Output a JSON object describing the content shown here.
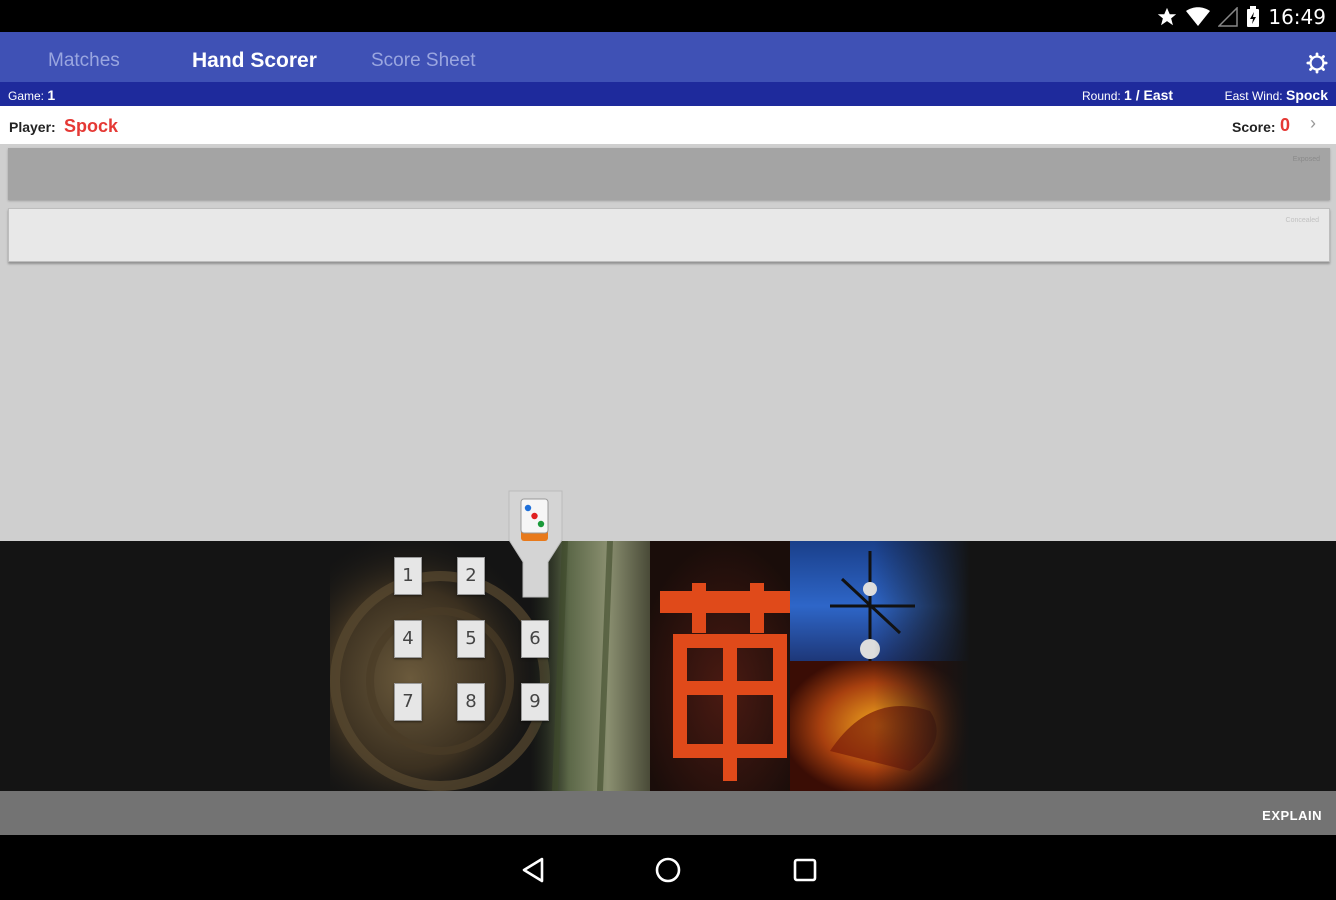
{
  "status_bar": {
    "time": "16:49",
    "icons": [
      "star-icon",
      "wifi-icon",
      "signal-icon",
      "battery-icon"
    ]
  },
  "tabs": [
    {
      "label": "Matches",
      "active": false
    },
    {
      "label": "Hand Scorer",
      "active": true
    },
    {
      "label": "Score Sheet",
      "active": false
    }
  ],
  "info": {
    "game_label": "Game:",
    "game_value": "1",
    "round_label": "Round:",
    "round_value": "1 / East",
    "east_wind_label": "East Wind:",
    "east_wind_value": "Spock"
  },
  "player": {
    "label": "Player:",
    "name": "Spock",
    "score_label": "Score:",
    "score": "0",
    "chevron": "›"
  },
  "panels": {
    "exposed_label": "Exposed",
    "concealed_label": "Concealed"
  },
  "keypad": {
    "keys": [
      "1",
      "2",
      "",
      "4",
      "5",
      "6",
      "7",
      "8",
      "9"
    ]
  },
  "actions": {
    "explain_label": "EXPLAIN"
  },
  "colors": {
    "primary": "#3f51b5",
    "info_bar": "#1e2a9c",
    "accent_red": "#e53935"
  }
}
